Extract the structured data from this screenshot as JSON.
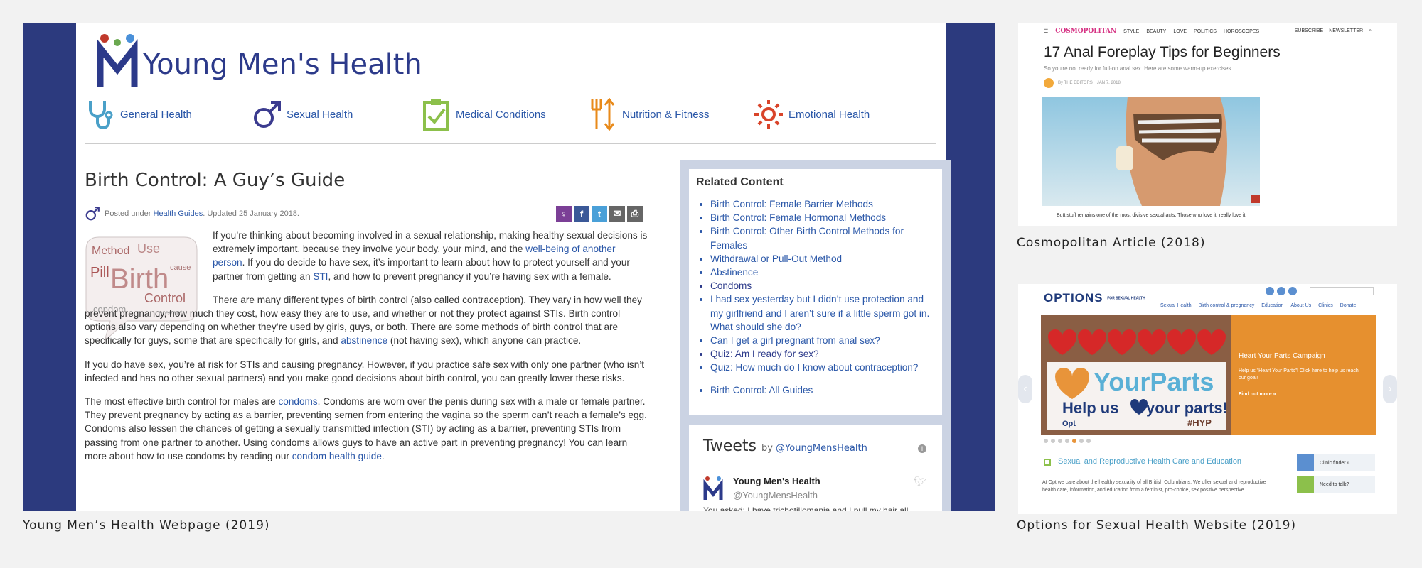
{
  "captions": {
    "ymh": "Young Men’s Health Webpage (2019)",
    "cosmo": "Cosmopolitan Article (2018)",
    "options": "Options for Sexual Health Website (2019)"
  },
  "ymh": {
    "brand": "Young Men's Health",
    "nav": [
      "General Health",
      "Sexual Health",
      "Medical Conditions",
      "Nutrition & Fitness",
      "Emotional Health"
    ],
    "title": "Birth Control: A Guy’s Guide",
    "meta_prefix": "Posted under ",
    "meta_link": "Health Guides",
    "meta_suffix": ". Updated 25 January 2018.",
    "wordcloud_words": [
      "Method",
      "Use",
      "Birth",
      "Pill",
      "Control",
      "condom",
      "cause",
      "prevent"
    ],
    "p1_a": "If you’re thinking about becoming involved in a sexual relationship, making healthy sexual decisions is extremely important, because they involve your body, your mind, and the ",
    "p1_link1": "well-being of another person",
    "p1_b": ". If you do decide to have sex, it’s important to learn about how to protect yourself and your partner from getting an ",
    "p1_link2": "STI",
    "p1_c": ", and how to prevent pregnancy if you’re having sex with a female.",
    "p2_a": "There are many different types of birth control (also called contraception). They vary in how well they prevent pregnancy, how much they cost, how easy they are to use, and whether or not they protect against STIs. Birth control options also vary depending on whether they’re used by girls, guys, or both. There are some methods of birth control that are specifically for guys, some that are specifically for girls, and ",
    "p2_link": "abstinence",
    "p2_b": " (not having sex), which anyone can practice.",
    "p3": "If you do have sex, you’re at risk for STIs and causing pregnancy. However, if you practice safe sex with only one partner (who isn’t infected and has no other sexual partners) and you make good decisions about birth control, you can greatly lower these risks.",
    "p4_a": "The most effective birth control for males are ",
    "p4_link1": "condoms",
    "p4_b": ". Condoms are worn over the penis during sex with a male or female partner. They prevent pregnancy by acting as a barrier, preventing semen from entering the vagina so the sperm can’t reach a female’s egg. Condoms also lessen the chances of getting a sexually transmitted infection (STI) by acting as a barrier, preventing STIs from passing from one partner to another. Using condoms allows guys to have an active part in preventing pregnancy! You can learn more about how to use condoms by reading our ",
    "p4_link2": "condom health guide",
    "p4_c": ".",
    "related_title": "Related Content",
    "related": [
      "Birth Control: Female Barrier Methods",
      "Birth Control: Female Hormonal Methods",
      "Birth Control: Other Birth Control Methods for Females",
      "Withdrawal or Pull-Out Method",
      "Abstinence",
      "Condoms",
      "I had sex yesterday but I didn’t use protection and my girlfriend and I aren’t sure if a little sperm got in. What should she do?",
      "Can I get a girl pregnant from anal sex?",
      "Quiz: Am I ready for sex?",
      "Quiz: How much do I know about contraception?"
    ],
    "related_all": "Birth Control: All Guides",
    "tweets_title": "Tweets",
    "tweets_by": "by ",
    "tweets_handle_link": "@YoungMensHealth",
    "tweet_name": "Young Men's Health",
    "tweet_handle": "@YoungMensHealth",
    "tweet_snip": "You asked: I have trichotillomania and I pull my hair all"
  },
  "cosmo": {
    "logo": "COSMOPOLITAN",
    "nav": [
      "STYLE",
      "BEAUTY",
      "LOVE",
      "POLITICS",
      "HOROSCOPES"
    ],
    "right": [
      "SUBSCRIBE",
      "NEWSLETTER"
    ],
    "title": "17 Anal Foreplay Tips for Beginners",
    "subtitle": "So you're not ready for full-on anal sex. Here are some warm-up exercises.",
    "byline": "By THE EDITORS",
    "date": "JAN 7, 2018",
    "lede": "Butt stuff remains one of the most divisive sexual acts. Those who love it, really love it."
  },
  "options": {
    "logo": "OPTIONS",
    "logo_small": "FOR SEXUAL HEALTH",
    "menu": [
      "Sexual Health",
      "Birth control & pregnancy",
      "Education",
      "About Us",
      "Clinics",
      "Donate"
    ],
    "hero_word": "YourParts",
    "hero_help": "Help us",
    "hero_help2": "your parts!",
    "hero_tag": "#HYP",
    "hero_org": "Opt",
    "hero_title": "Heart Your Parts Campaign",
    "hero_body": "Help us \"Heart Your Parts\"! Click here to help us reach our goal!",
    "hero_more": "Find out more »",
    "section_title": "Sexual and Reproductive Health Care and Education",
    "intro": "At Opt we care about the healthy sexuality of all British Columbians. We offer sexual and reproductive health care, information, and education from a feminist, pro-choice, sex positive perspective.",
    "quick": [
      "Clinic finder »",
      "Need to talk?"
    ]
  }
}
